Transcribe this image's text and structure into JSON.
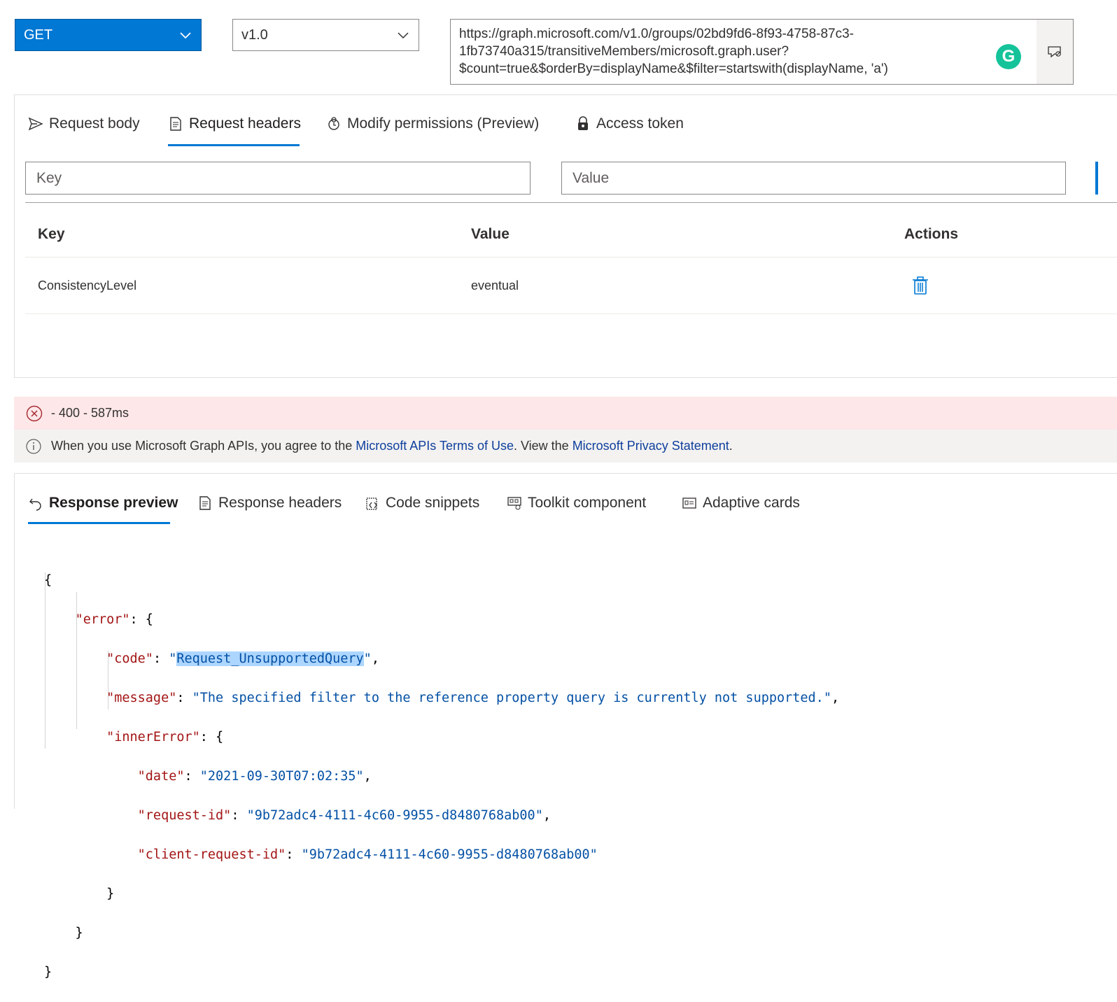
{
  "toolbar": {
    "method": "GET",
    "version": "v1.0",
    "url": "https://graph.microsoft.com/v1.0/groups/02bd9fd6-8f93-4758-87c3-1fb73740a315/transitiveMembers/microsoft.graph.user?$count=true&$orderBy=displayName&$filter=startswith(displayName, 'a')",
    "url_lines": [
      "https://graph.microsoft.com/v1.0/groups/02bd9fd6-8f93-4758-87c3-",
      "1fb73740a315/transitiveMembers/microsoft.graph.user?",
      "$count=true&$orderBy=displayName&$filter=startswith(displayName, 'a')"
    ],
    "grammarly_letter": "G"
  },
  "request_tabs": [
    {
      "label": "Request body",
      "icon": "send-icon"
    },
    {
      "label": "Request headers",
      "icon": "document-icon",
      "active": true
    },
    {
      "label": "Modify permissions (Preview)",
      "icon": "permissions-icon"
    },
    {
      "label": "Access token",
      "icon": "lock-icon"
    }
  ],
  "headers_form": {
    "key_placeholder": "Key",
    "value_placeholder": "Value"
  },
  "headers_table": {
    "columns": [
      "Key",
      "Value",
      "Actions"
    ],
    "rows": [
      {
        "key": "ConsistencyLevel",
        "value": "eventual"
      }
    ]
  },
  "status": {
    "text": "- 400 - 587ms",
    "color": "#fde7e9"
  },
  "info": {
    "prefix": "When you use Microsoft Graph APIs, you agree to the ",
    "terms_link": "Microsoft APIs Terms of Use",
    "middle": ". View the ",
    "privacy_link": "Microsoft Privacy Statement",
    "suffix": "."
  },
  "response_tabs": [
    {
      "label": "Response preview",
      "icon": "undo-icon",
      "active": true
    },
    {
      "label": "Response headers",
      "icon": "document-icon"
    },
    {
      "label": "Code snippets",
      "icon": "code-icon"
    },
    {
      "label": "Toolkit component",
      "icon": "toolkit-icon"
    },
    {
      "label": "Adaptive cards",
      "icon": "card-icon"
    }
  ],
  "response": {
    "code_value": "Request_UnsupportedQuery",
    "message_value": "The specified filter to the reference property query is currently not supported.",
    "date_value": "2021-09-30T07:02:35",
    "request_id_value": "9b72adc4-4111-4c60-9955-d8480768ab00",
    "client_request_id_value": "9b72adc4-4111-4c60-9955-d8480768ab00"
  },
  "colors": {
    "accent": "#0078d4",
    "json_key": "#a31515",
    "json_string": "#0451a5",
    "error_bg": "#fde7e9"
  }
}
